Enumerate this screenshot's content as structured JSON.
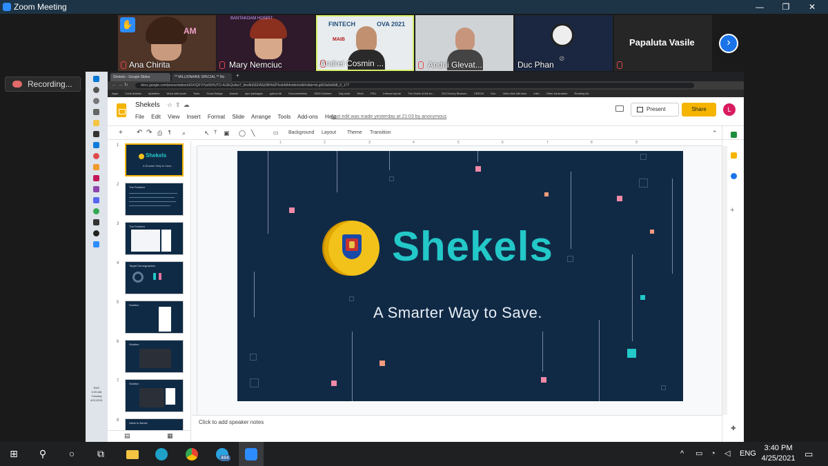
{
  "window": {
    "title": "Zoom Meeting",
    "minimize": "—",
    "restore": "❐",
    "close": "✕"
  },
  "participants": [
    {
      "name": "Ana Chirita",
      "muted": true,
      "bg": "#5c3b2c"
    },
    {
      "name": "Mary Nemciuc",
      "muted": true,
      "bg": "#3b1f33"
    },
    {
      "name": "Andrei Cosmin ...",
      "muted": true,
      "bg": "#dfe6ea"
    },
    {
      "name": "Andrii Glevat...",
      "muted": true,
      "bg": "#d9dcdf"
    },
    {
      "name": "Duc Phan",
      "muted": false,
      "bg": "#1b2740"
    },
    {
      "name": "Papaluta Vasile",
      "muted": true,
      "bg": "#262626"
    }
  ],
  "tile_texts": {
    "fintech": "FINTECH",
    "fintech_year": "OVA 2021",
    "maib": "MAIB",
    "hackathon": "BANTAKOAM HOSPIT"
  },
  "recording": {
    "label": "Recording..."
  },
  "browser": {
    "tabs": [
      {
        "label": "Shekels - Google Slides",
        "active": true
      },
      {
        "label": "** MILLIONAIRE SPECIAL ** Ro",
        "active": false
      }
    ],
    "new_tab": "+",
    "url": "docs.google.com/presentation/d/1KIQFVYjo66HUTO-A1IEQvikw7_ttreAhDEFA6y5BHdJPIcnkfdhfvtdm/edit#slide=id.gb53a0e8d8_0_177",
    "bookmarks": [
      "Apps",
      "Code Articles",
      "Aptstrtive",
      "Work with Israel",
      "Tools",
      "Good Design",
      "Assets",
      "npm packages",
      "python lib",
      "Documentation",
      "SIDN Scheme",
      "Day work",
      "Work",
      "PSU",
      "Infernal repute",
      "The Guide of the bu...",
      "GUI Survey Bearson",
      "CREON",
      "Doc",
      "Video that still does",
      "child",
      "Other bookmarks",
      "Reading list"
    ]
  },
  "slides_app": {
    "title": "Shekels",
    "star": "☆",
    "move": "⇪",
    "cloud": "☁",
    "menu": [
      "File",
      "Edit",
      "View",
      "Insert",
      "Format",
      "Slide",
      "Arrange",
      "Tools",
      "Add-ons",
      "Help"
    ],
    "last_edit": "Last edit was made yesterday at 21:03 by anonymous",
    "present": "Present",
    "share": "Share",
    "avatar": "L",
    "toolbar": {
      "add": "+",
      "undo": "↶",
      "redo": "↷",
      "print": "⎙",
      "paint": "¶",
      "zoom": "⌕",
      "select": "↖",
      "text": "T",
      "image": "▣",
      "shape": "◯",
      "line": "╲",
      "comment": "▭",
      "background": "Background",
      "layout": "Layout",
      "theme": "Theme",
      "transition": "Transition",
      "collapse": "⌃"
    },
    "ruler": [
      "1",
      "2",
      "3",
      "4",
      "5",
      "6",
      "7",
      "8",
      "9"
    ],
    "thumbnails": [
      {
        "num": "1",
        "title": "Shekels",
        "subtitle": "A Smarter Way to Save."
      },
      {
        "num": "2",
        "title": "The Problem"
      },
      {
        "num": "3",
        "title": "The Problem"
      },
      {
        "num": "4",
        "title": "Target Demographics"
      },
      {
        "num": "5",
        "title": "Solution"
      },
      {
        "num": "6",
        "title": "Solution"
      },
      {
        "num": "7",
        "title": "Solution"
      },
      {
        "num": "8",
        "title": "Value to Banks"
      }
    ],
    "slide": {
      "brand": "Shekels",
      "tagline": "A Smarter Way to Save."
    },
    "speaker_notes": "Click to add speaker notes",
    "grid_view": "▦",
    "list_view": "▤",
    "explore": "✚"
  },
  "windows_sidebar": {
    "time": "3:39 AM",
    "day": "Tuesday",
    "date": "4/21/2021",
    "lang": "ENG"
  },
  "taskbar": {
    "start": "⊞",
    "search": "⚲",
    "cortana": "○",
    "taskview": "⧉",
    "telegram_badge": "484",
    "tray_up": "^",
    "lang": "ENG",
    "time": "3:40 PM",
    "date": "4/25/2021",
    "notifications": "▭"
  },
  "colors": {
    "zoom_titlebar": "#1d3446",
    "slide_bg": "#102a46",
    "brand_teal": "#23c8c8",
    "share_yellow": "#f4b400",
    "zoom_blue": "#2d8cff"
  }
}
